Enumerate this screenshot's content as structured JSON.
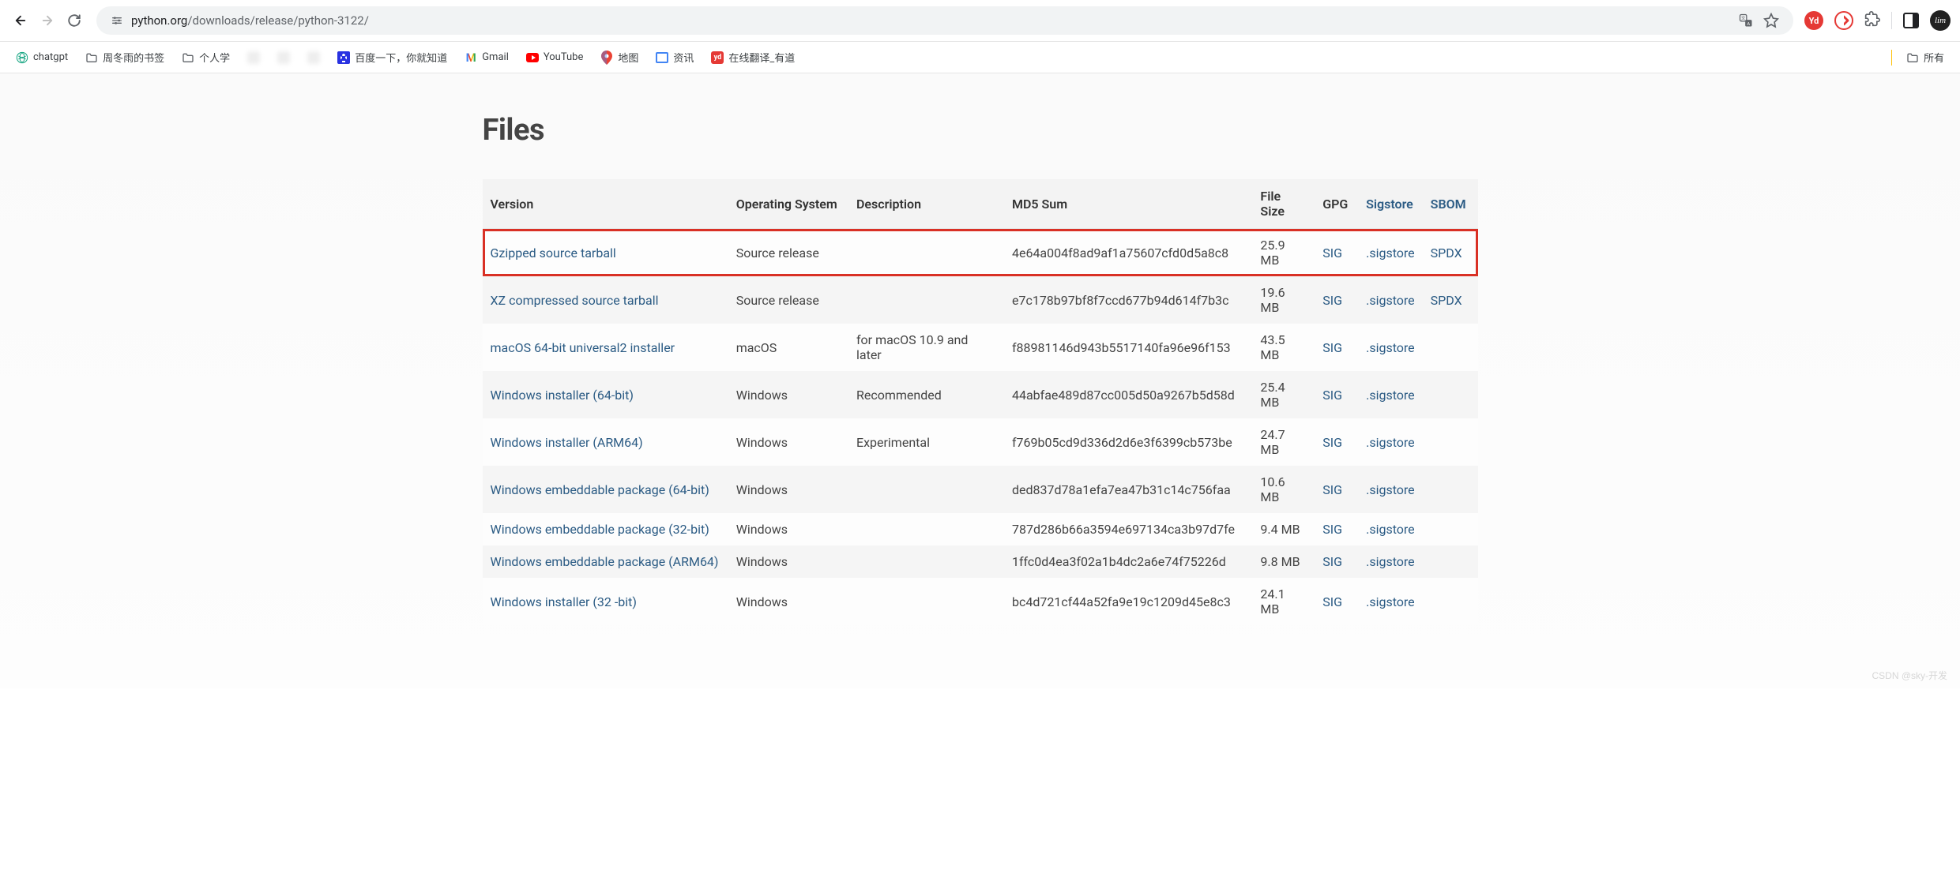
{
  "browser": {
    "url_domain": "python.org",
    "url_path": "/downloads/release/python-3122/",
    "avatar": "lim"
  },
  "bookmarks": [
    {
      "icon": "chatgpt",
      "label": "chatgpt"
    },
    {
      "icon": "folder",
      "label": "周冬雨的书签"
    },
    {
      "icon": "folder",
      "label": "个人学"
    },
    {
      "icon": "blur",
      "label": ""
    },
    {
      "icon": "blur",
      "label": ""
    },
    {
      "icon": "blur",
      "label": ""
    },
    {
      "icon": "baidu",
      "label": "百度一下，你就知道"
    },
    {
      "icon": "gmail",
      "label": "Gmail"
    },
    {
      "icon": "youtube",
      "label": "YouTube"
    },
    {
      "icon": "gmaps",
      "label": "地图"
    },
    {
      "icon": "news",
      "label": "资讯"
    },
    {
      "icon": "youdao",
      "label": "在线翻译_有道"
    }
  ],
  "bookmarks_overflow": "所有",
  "page": {
    "title": "Files",
    "headers": {
      "version": "Version",
      "os": "Operating System",
      "desc": "Description",
      "md5": "MD5 Sum",
      "size": "File Size",
      "gpg": "GPG",
      "sigstore": "Sigstore",
      "sbom": "SBOM"
    },
    "rows": [
      {
        "version": "Gzipped source tarball",
        "os": "Source release",
        "desc": "",
        "md5": "4e64a004f8ad9af1a75607cfd0d5a8c8",
        "size": "25.9 MB",
        "gpg": "SIG",
        "sig": ".sigstore",
        "sbom": "SPDX",
        "highlight": true
      },
      {
        "version": "XZ compressed source tarball",
        "os": "Source release",
        "desc": "",
        "md5": "e7c178b97bf8f7ccd677b94d614f7b3c",
        "size": "19.6 MB",
        "gpg": "SIG",
        "sig": ".sigstore",
        "sbom": "SPDX"
      },
      {
        "version": "macOS 64-bit universal2 installer",
        "os": "macOS",
        "desc": "for macOS 10.9 and later",
        "md5": "f88981146d943b5517140fa96e96f153",
        "size": "43.5 MB",
        "gpg": "SIG",
        "sig": ".sigstore",
        "sbom": ""
      },
      {
        "version": "Windows installer (64-bit)",
        "os": "Windows",
        "desc": "Recommended",
        "md5": "44abfae489d87cc005d50a9267b5d58d",
        "size": "25.4 MB",
        "gpg": "SIG",
        "sig": ".sigstore",
        "sbom": ""
      },
      {
        "version": "Windows installer (ARM64)",
        "os": "Windows",
        "desc": "Experimental",
        "md5": "f769b05cd9d336d2d6e3f6399cb573be",
        "size": "24.7 MB",
        "gpg": "SIG",
        "sig": ".sigstore",
        "sbom": ""
      },
      {
        "version": "Windows embeddable package (64-bit)",
        "os": "Windows",
        "desc": "",
        "md5": "ded837d78a1efa7ea47b31c14c756faa",
        "size": "10.6 MB",
        "gpg": "SIG",
        "sig": ".sigstore",
        "sbom": ""
      },
      {
        "version": "Windows embeddable package (32-bit)",
        "os": "Windows",
        "desc": "",
        "md5": "787d286b66a3594e697134ca3b97d7fe",
        "size": "9.4 MB",
        "gpg": "SIG",
        "sig": ".sigstore",
        "sbom": ""
      },
      {
        "version": "Windows embeddable package (ARM64)",
        "os": "Windows",
        "desc": "",
        "md5": "1ffc0d4ea3f02a1b4dc2a6e74f75226d",
        "size": "9.8 MB",
        "gpg": "SIG",
        "sig": ".sigstore",
        "sbom": ""
      },
      {
        "version": "Windows installer (32 -bit)",
        "os": "Windows",
        "desc": "",
        "md5": "bc4d721cf44a52fa9e19c1209d45e8c3",
        "size": "24.1 MB",
        "gpg": "SIG",
        "sig": ".sigstore",
        "sbom": ""
      }
    ]
  },
  "watermark": "CSDN @sky-开发"
}
